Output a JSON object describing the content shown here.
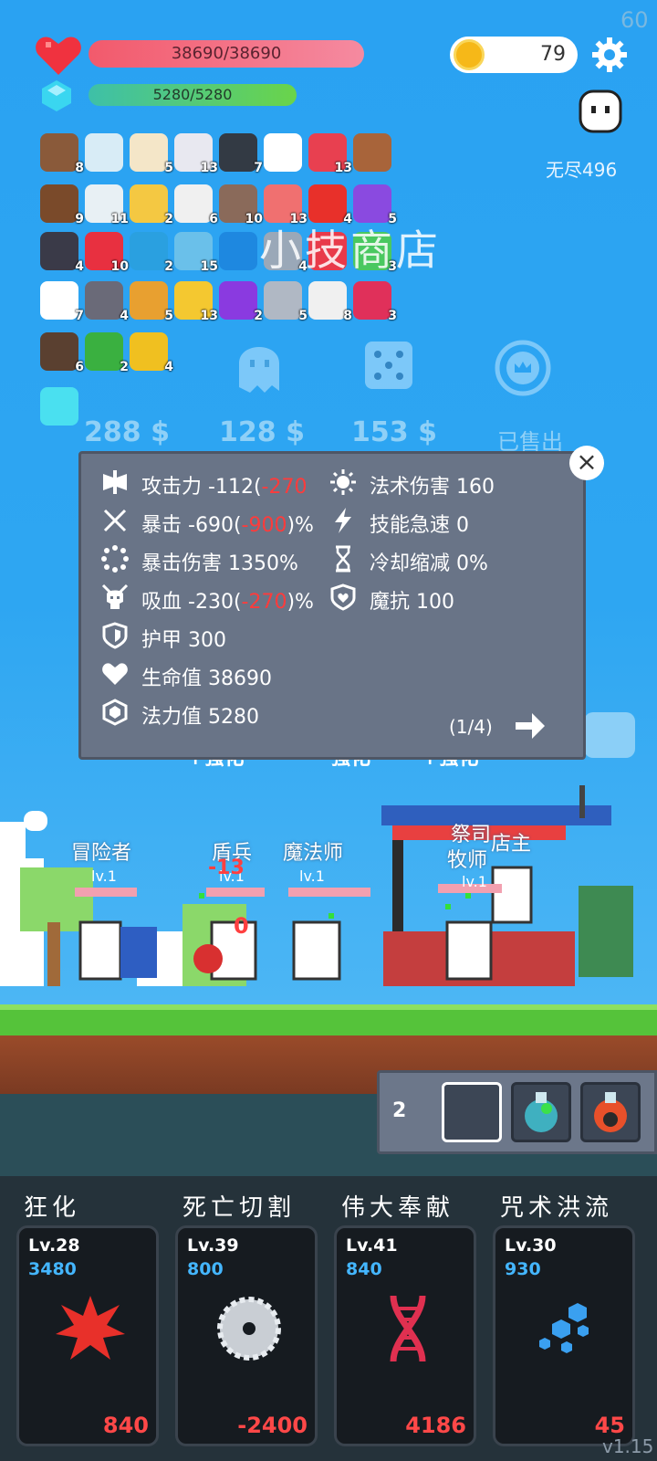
{
  "fps": "60",
  "hp": "38690/38690",
  "mp": "5280/5280",
  "coins": "79",
  "endless": "无尽496",
  "items": [
    {
      "icon": "shield-wood-icon",
      "count": "8"
    },
    {
      "icon": "magnifier-icon",
      "count": ""
    },
    {
      "icon": "moon-icon",
      "count": "5"
    },
    {
      "icon": "unicorn-icon",
      "count": "13"
    },
    {
      "icon": "piggy-bank-icon",
      "count": "7"
    },
    {
      "icon": "question-icon",
      "count": ""
    },
    {
      "icon": "red-shield-icon",
      "count": "13"
    },
    {
      "icon": "chest-icon",
      "count": ""
    },
    {
      "icon": "bow-icon",
      "count": "9"
    },
    {
      "icon": "boot-icon",
      "count": "11"
    },
    {
      "icon": "ring-icon",
      "count": "2"
    },
    {
      "icon": "envelope-icon",
      "count": "6"
    },
    {
      "icon": "tombstone-icon",
      "count": "10"
    },
    {
      "icon": "pill-icon",
      "count": "13"
    },
    {
      "icon": "apple-icon",
      "count": "4"
    },
    {
      "icon": "star-box-icon",
      "count": "5"
    },
    {
      "icon": "hook-icon",
      "count": "4"
    },
    {
      "icon": "strawberry-icon",
      "count": "10"
    },
    {
      "icon": "fish-icon",
      "count": "2"
    },
    {
      "icon": "bubble-icon",
      "count": "15"
    },
    {
      "icon": "blue-gem-icon",
      "count": ""
    },
    {
      "icon": "sword-icon",
      "count": "4"
    },
    {
      "icon": "hearts-icon",
      "count": ""
    },
    {
      "icon": "potion-green-icon",
      "count": "3"
    },
    {
      "icon": "ghost-icon",
      "count": "7"
    },
    {
      "icon": "spiked-mace-icon",
      "count": "4"
    },
    {
      "icon": "book-icon",
      "count": "5"
    },
    {
      "icon": "sunflower-icon",
      "count": "13"
    },
    {
      "icon": "crystal-ball-icon",
      "count": "2"
    },
    {
      "icon": "axe-icon",
      "count": "5"
    },
    {
      "icon": "dice-icon",
      "count": "8"
    },
    {
      "icon": "jar-icon",
      "count": "3"
    },
    {
      "icon": "meteor-icon",
      "count": "6"
    },
    {
      "icon": "watermelon-icon",
      "count": "2"
    },
    {
      "icon": "magic-wand-icon",
      "count": "4"
    },
    {
      "icon": "glow-box-icon",
      "count": ""
    }
  ],
  "shop_overlay": "小技商店",
  "shop": {
    "prices": [
      "288 $",
      "128 $",
      "153 $"
    ],
    "sold": "已售出"
  },
  "stats": {
    "attack_label": "攻击力",
    "attack_value": "-112(",
    "attack_red": "-270",
    "crit_label": "暴击",
    "crit_value": "-690(",
    "crit_red": "-900",
    "crit_suffix": ")%",
    "crit_dmg_label": "暴击伤害",
    "crit_dmg_value": "1350%",
    "lifesteal_label": "吸血",
    "lifesteal_value": "-230(",
    "lifesteal_red": "-270",
    "lifesteal_suffix": ")%",
    "armor_label": "护甲",
    "armor_value": "300",
    "hp_label": "生命值",
    "hp_value": "38690",
    "mana_label": "法力值",
    "mana_value": "5280",
    "magic_dmg_label": "法术伤害",
    "magic_dmg_value": "160",
    "haste_label": "技能急速",
    "haste_value": "0",
    "cdr_label": "冷却缩减",
    "cdr_value": "0%",
    "mr_label": "魔抗",
    "mr_value": "100",
    "page": "(1/4)"
  },
  "behind_panel": [
    "+强化",
    "强化",
    "+强化"
  ],
  "units": [
    {
      "name": "冒险者",
      "lv": "lv.1"
    },
    {
      "name": "盾兵",
      "lv": "lv.1"
    },
    {
      "name": "魔法师",
      "lv": "lv.1"
    },
    {
      "name": "店主",
      "lv": ""
    },
    {
      "name": "祭司",
      "lv": ""
    },
    {
      "name": "牧师",
      "lv": "lv.1"
    }
  ],
  "dmg_popups": [
    "-13",
    "0"
  ],
  "potion_count": "2",
  "skills": [
    {
      "name": "狂化",
      "lv": "Lv.28",
      "cost": "3480",
      "value": "840",
      "icon": "red-splat-icon"
    },
    {
      "name": "死亡切割",
      "lv": "Lv.39",
      "cost": "800",
      "value": "-2400",
      "icon": "saw-blade-icon"
    },
    {
      "name": "伟大奉献",
      "lv": "Lv.41",
      "cost": "840",
      "value": "4186",
      "icon": "dna-icon"
    },
    {
      "name": "咒术洪流",
      "lv": "Lv.30",
      "cost": "930",
      "value": "45",
      "icon": "hexagons-icon"
    }
  ],
  "version": "v1.15"
}
